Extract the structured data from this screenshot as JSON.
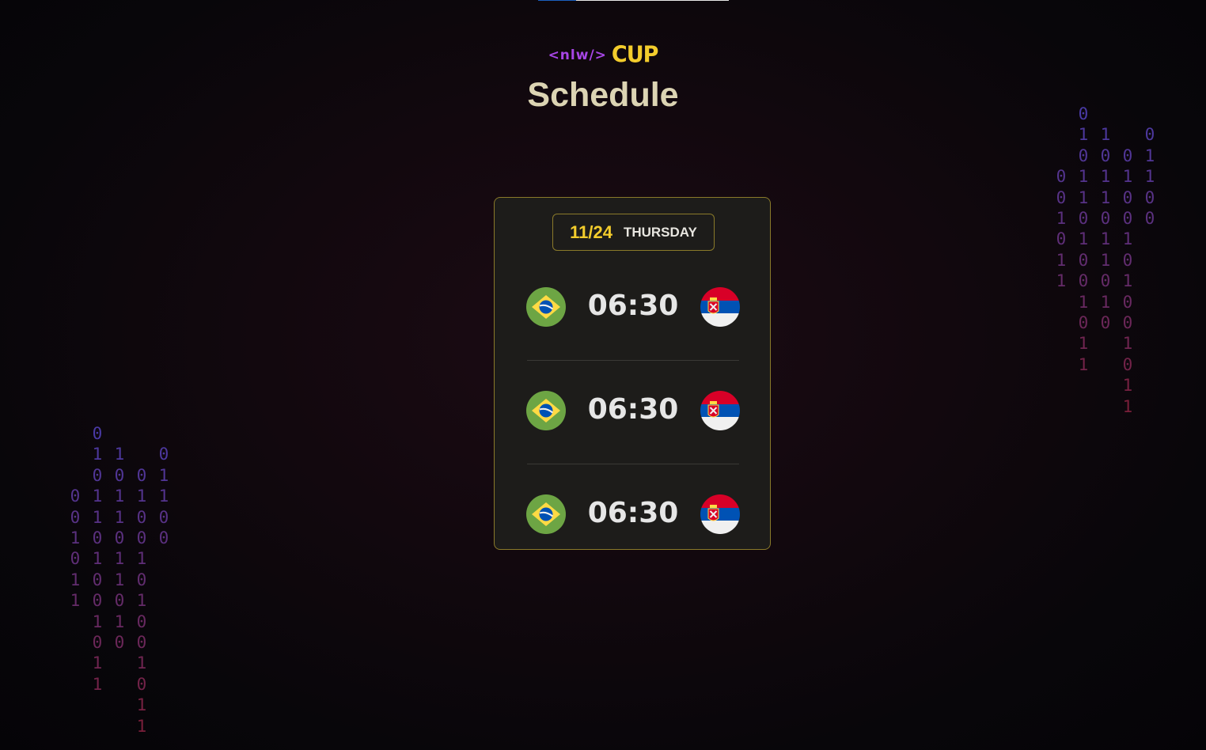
{
  "header": {
    "logo_prefix": "<nlw/>",
    "logo_suffix": "CUP",
    "title": "Schedule"
  },
  "schedule": {
    "date": "11/24",
    "weekday": "THURSDAY",
    "matches": [
      {
        "home_team": "Brazil",
        "home_flag": "brazil-flag",
        "time": "06:30",
        "away_team": "Serbia",
        "away_flag": "serbia-flag"
      },
      {
        "home_team": "Brazil",
        "home_flag": "brazil-flag",
        "time": "06:30",
        "away_team": "Serbia",
        "away_flag": "serbia-flag"
      },
      {
        "home_team": "Brazil",
        "home_flag": "brazil-flag",
        "time": "06:30",
        "away_team": "Serbia",
        "away_flag": "serbia-flag"
      }
    ]
  },
  "decor": {
    "binary_left": [
      [
        "",
        "",
        "",
        "0",
        "0",
        "1",
        "0",
        "1",
        "1",
        "",
        "",
        "",
        ""
      ],
      [
        "0",
        "1",
        "0",
        "1",
        "1",
        "0",
        "1",
        "0",
        "0",
        "1",
        "0",
        "1",
        "1"
      ],
      [
        "",
        "1",
        "0",
        "1",
        "1",
        "0",
        "1",
        "1",
        "0",
        "1",
        "0",
        "",
        ""
      ],
      [
        "",
        "",
        "0",
        "1",
        "0",
        "0",
        "1",
        "0",
        "1",
        "0",
        "0",
        "1",
        "0",
        "1",
        "1"
      ],
      [
        "",
        "0",
        "1",
        "1",
        "0",
        "0",
        "",
        "",
        "",
        "",
        "",
        "",
        ""
      ]
    ],
    "binary_right": [
      [
        "",
        "",
        "",
        "0",
        "0",
        "1",
        "0",
        "1",
        "1",
        "",
        "",
        "",
        ""
      ],
      [
        "0",
        "1",
        "0",
        "1",
        "1",
        "0",
        "1",
        "0",
        "0",
        "1",
        "0",
        "1",
        "1"
      ],
      [
        "",
        "1",
        "0",
        "1",
        "1",
        "0",
        "1",
        "1",
        "0",
        "1",
        "0",
        "",
        ""
      ],
      [
        "",
        "",
        "0",
        "1",
        "0",
        "0",
        "1",
        "0",
        "1",
        "0",
        "0",
        "1",
        "0",
        "1",
        "1"
      ],
      [
        "",
        "0",
        "1",
        "1",
        "0",
        "0",
        "",
        "",
        "",
        "",
        "",
        "",
        ""
      ]
    ],
    "colors": {
      "binary_top": "#4a3aa6",
      "binary_bottom": "#7a1f3a",
      "accent_yellow": "#f3cc2c",
      "accent_purple": "#a746e6",
      "title": "#dcd4b3"
    }
  }
}
